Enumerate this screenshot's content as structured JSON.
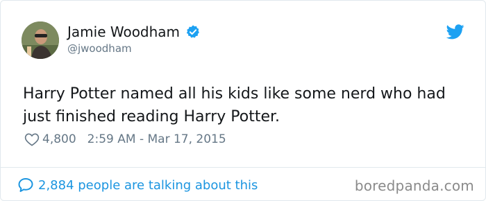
{
  "author": {
    "name": "Jamie Woodham",
    "handle": "@jwoodham",
    "verified": true,
    "avatar_icon": "user-avatar-photo"
  },
  "tweet": {
    "text": "Harry Potter named all his kids like some nerd who had just finished reading Harry Potter.",
    "likes": "4,800",
    "timestamp": "2:59 AM - Mar 17, 2015"
  },
  "footer": {
    "talking": "2,884 people are talking about this"
  },
  "watermark": "boredpanda.com",
  "colors": {
    "accent": "#1da1f2",
    "link": "#1b95e0",
    "muted": "#657786",
    "text": "#14171a",
    "border": "#e1e8ed"
  },
  "icons": {
    "brand": "twitter-bird-icon",
    "verified": "verified-badge-icon",
    "like": "heart-icon",
    "reply": "comment-bubble-icon"
  }
}
